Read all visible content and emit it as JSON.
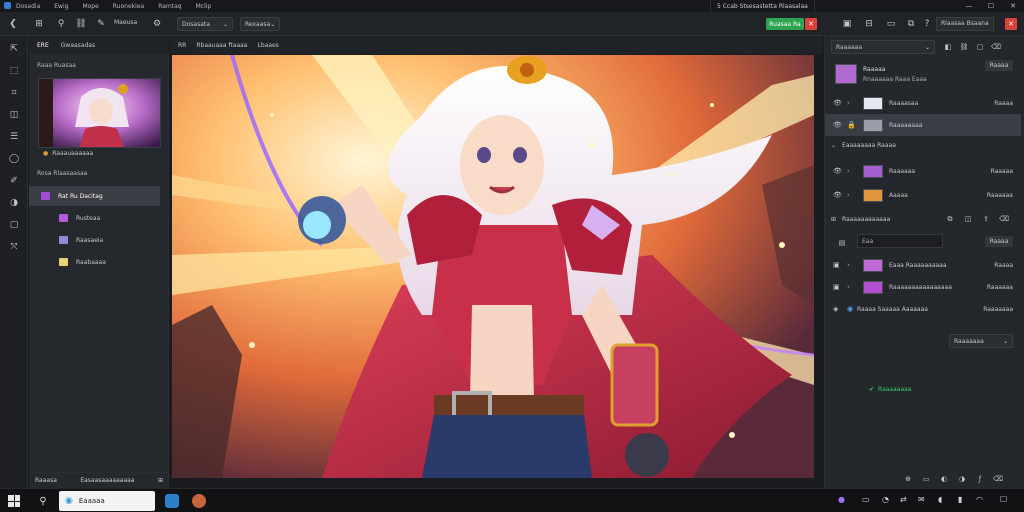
{
  "menubar": {
    "items": [
      "Dosadia",
      "Ewig",
      "Mope",
      "Ruonekiea",
      "Ramtaq",
      "Mclip"
    ],
    "window_title": "5 Ccab Stsesastetta Rlaasalaa",
    "controls": [
      "—",
      "☐",
      "✕"
    ]
  },
  "toolbar": {
    "label_a": "Maeusa",
    "dropdown_a": "Dosasata",
    "dropdown_b": "Rexaasa",
    "export_label": "Ruasaa Ra",
    "search_placeholder": "Rlaasaa Bsaana"
  },
  "left_panel": {
    "tabs": [
      "ERE",
      "Gwaasadas"
    ],
    "section_title": "Raaa Ruasaa",
    "thumb_caption": "Raaauaaaaaa",
    "tree_title": "Rosa Rlaasaasaa",
    "tree": [
      {
        "label": "Rat Ru Dacitag",
        "color": "#a24bd6"
      },
      {
        "label": "Rusteaa",
        "color": "#b15bd8"
      },
      {
        "label": "Raasaeia",
        "color": "#8a8ed6"
      },
      {
        "label": "Raabaaaa",
        "color": "#e6d37a"
      }
    ],
    "footer_left": "Raaasa",
    "footer_mid": "Easaasaaaaaaaaa"
  },
  "canvas": {
    "tabs": [
      "RR",
      "Rbaauaaa ftaaaa",
      "Lbaaes"
    ]
  },
  "right_panel": {
    "dropdown": "Raaaaaa",
    "header_name": "Raaaaa",
    "header_sub": "Rnaaaaaa Raaa Eaaa",
    "small_btn": "Raaaa",
    "layers": [
      {
        "label": "Raaaasaa",
        "tag": "Raaaa"
      },
      {
        "label": "Raaaaaaaa",
        "tag": ""
      }
    ],
    "group_title": "Eaaaaaaaa Raaaa",
    "group_layers": [
      {
        "label": "Raaaaaa",
        "tag": "Raaaaa"
      },
      {
        "label": "Aaaaa",
        "tag": "Raaaaaa"
      }
    ],
    "fx_title": "Raaaaaaaaaaaa",
    "fx_search": "Eaa",
    "fx_btn": "Raaaa",
    "fx_items": [
      {
        "label": "Eaaa Raaaaaaaaaa",
        "tag": "Raaaa"
      },
      {
        "label": "Raaaaaaaaaaaaaaaa",
        "tag": "Raaaaaa"
      },
      {
        "label": "Raaaa Saaaaa Aaaaaaa",
        "tag": "Raaaaaaa"
      }
    ],
    "bottom_dropdown": "Raaaaaaa",
    "status_text": "Raaaaaaaa"
  },
  "taskbar": {
    "search_text": "Eaaaaa"
  },
  "colors": {
    "accent_green": "#2ea44f",
    "close_red": "#d9433a",
    "selected_row": "#3a3d43"
  }
}
